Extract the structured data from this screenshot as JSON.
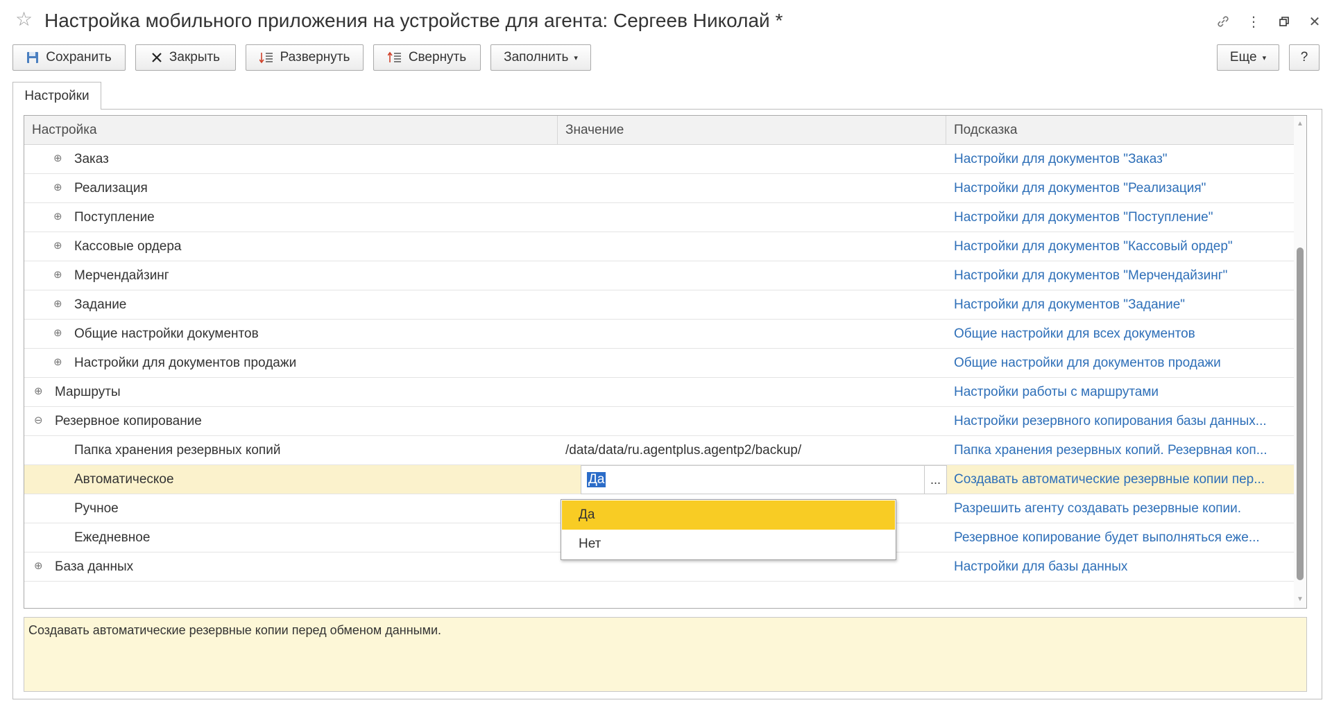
{
  "window": {
    "title": "Настройка мобильного приложения на устройстве для агента: Сергеев Николай *"
  },
  "toolbar": {
    "save": "Сохранить",
    "close": "Закрыть",
    "expand": "Развернуть",
    "collapse": "Свернуть",
    "fill": "Заполнить",
    "more": "Еще",
    "help": "?"
  },
  "tabs": {
    "settings": "Настройки"
  },
  "grid": {
    "columns": {
      "setting": "Настройка",
      "value": "Значение",
      "hint": "Подсказка"
    },
    "rows": [
      {
        "name": "Заказ",
        "value": "",
        "hint": "Настройки для документов \"Заказ\"",
        "level": 1,
        "state": "collapsed"
      },
      {
        "name": "Реализация",
        "value": "",
        "hint": "Настройки для документов \"Реализация\"",
        "level": 1,
        "state": "collapsed"
      },
      {
        "name": "Поступление",
        "value": "",
        "hint": "Настройки для документов \"Поступление\"",
        "level": 1,
        "state": "collapsed"
      },
      {
        "name": "Кассовые ордера",
        "value": "",
        "hint": "Настройки для документов \"Кассовый ордер\"",
        "level": 1,
        "state": "collapsed"
      },
      {
        "name": "Мерчендайзинг",
        "value": "",
        "hint": "Настройки для документов \"Мерчендайзинг\"",
        "level": 1,
        "state": "collapsed"
      },
      {
        "name": "Задание",
        "value": "",
        "hint": "Настройки для документов \"Задание\"",
        "level": 1,
        "state": "collapsed"
      },
      {
        "name": "Общие настройки документов",
        "value": "",
        "hint": "Общие настройки для всех документов",
        "level": 1,
        "state": "collapsed"
      },
      {
        "name": "Настройки для документов продажи",
        "value": "",
        "hint": "Общие настройки для документов продажи",
        "level": 1,
        "state": "collapsed"
      },
      {
        "name": "Маршруты",
        "value": "",
        "hint": "Настройки работы с маршрутами",
        "level": 0,
        "state": "collapsed"
      },
      {
        "name": "Резервное копирование",
        "value": "",
        "hint": "Настройки резервного копирования базы данных...",
        "level": 0,
        "state": "expanded"
      },
      {
        "name": "Папка хранения резервных копий",
        "value": "/data/data/ru.agentplus.agentp2/backup/",
        "hint": "Папка хранения резервных копий. Резервная коп...",
        "level": 1,
        "state": "leaf"
      },
      {
        "name": "Автоматическое",
        "value": "Да",
        "hint": "Создавать автоматические резервные копии пер...",
        "level": 1,
        "state": "leaf",
        "selected": true
      },
      {
        "name": "Ручное",
        "value": "",
        "hint": "Разрешить агенту создавать резервные копии.",
        "level": 1,
        "state": "leaf"
      },
      {
        "name": "Ежедневное",
        "value": "",
        "hint": "Резервное копирование будет выполняться еже...",
        "level": 1,
        "state": "leaf"
      },
      {
        "name": "База данных",
        "value": "",
        "hint": "Настройки для базы данных",
        "level": 0,
        "state": "collapsed"
      }
    ]
  },
  "dropdown": {
    "options": [
      "Да",
      "Нет"
    ],
    "highlighted": "Да"
  },
  "edit_button": "...",
  "hint_panel": {
    "text": "Создавать автоматические резервные копии перед обменом данными."
  },
  "colors": {
    "hint_link": "#2e6fb8",
    "selected_row": "#fbf2cc",
    "dropdown_highlight": "#f8cc24",
    "hint_panel_bg": "#fdf7d7"
  }
}
